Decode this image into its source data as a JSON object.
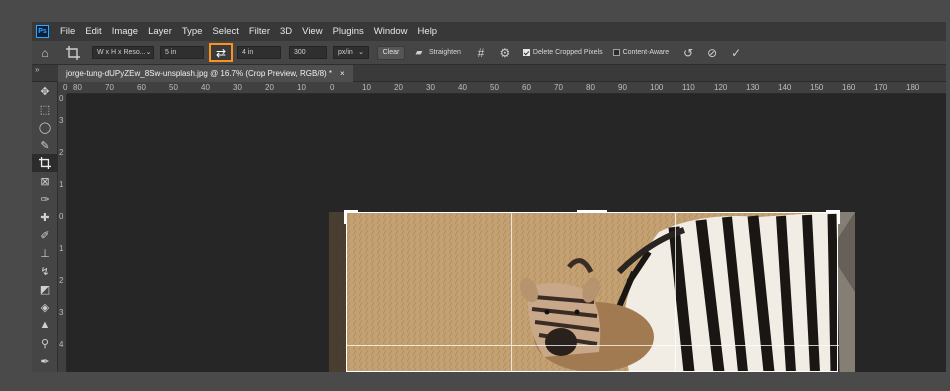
{
  "app": {
    "logo_text": "Ps"
  },
  "menu": [
    "File",
    "Edit",
    "Image",
    "Layer",
    "Type",
    "Select",
    "Filter",
    "3D",
    "View",
    "Plugins",
    "Window",
    "Help"
  ],
  "options": {
    "preset": "W x H x Reso...",
    "width": "5 in",
    "height": "4 in",
    "resolution": "300",
    "units": "px/in",
    "clear_label": "Clear",
    "straighten_label": "Straighten",
    "delete_cropped_label": "Delete Cropped Pixels",
    "delete_cropped_checked": true,
    "content_aware_label": "Content-Aware",
    "content_aware_checked": false
  },
  "panel_collapse": "»",
  "document": {
    "tab_title": "jorge-tung-dUPyZEw_8Sw-unsplash.jpg @ 16.7% (Crop Preview, RGB/8) *",
    "close": "×"
  },
  "ruler": {
    "h_labels": [
      "0",
      "80",
      "70",
      "60",
      "50",
      "40",
      "30",
      "20",
      "10",
      "0",
      "10",
      "20",
      "30",
      "40",
      "50",
      "60",
      "70",
      "80",
      "90",
      "100",
      "110",
      "120",
      "130",
      "140",
      "150",
      "160",
      "170",
      "180"
    ],
    "v_labels": [
      "0",
      "3",
      "2",
      "1",
      "0",
      "1",
      "2",
      "3",
      "4"
    ]
  },
  "colors": {
    "accent_swap_border": "#f7931e",
    "canvas_bg": "#262626",
    "menubar_bg": "#383838"
  }
}
